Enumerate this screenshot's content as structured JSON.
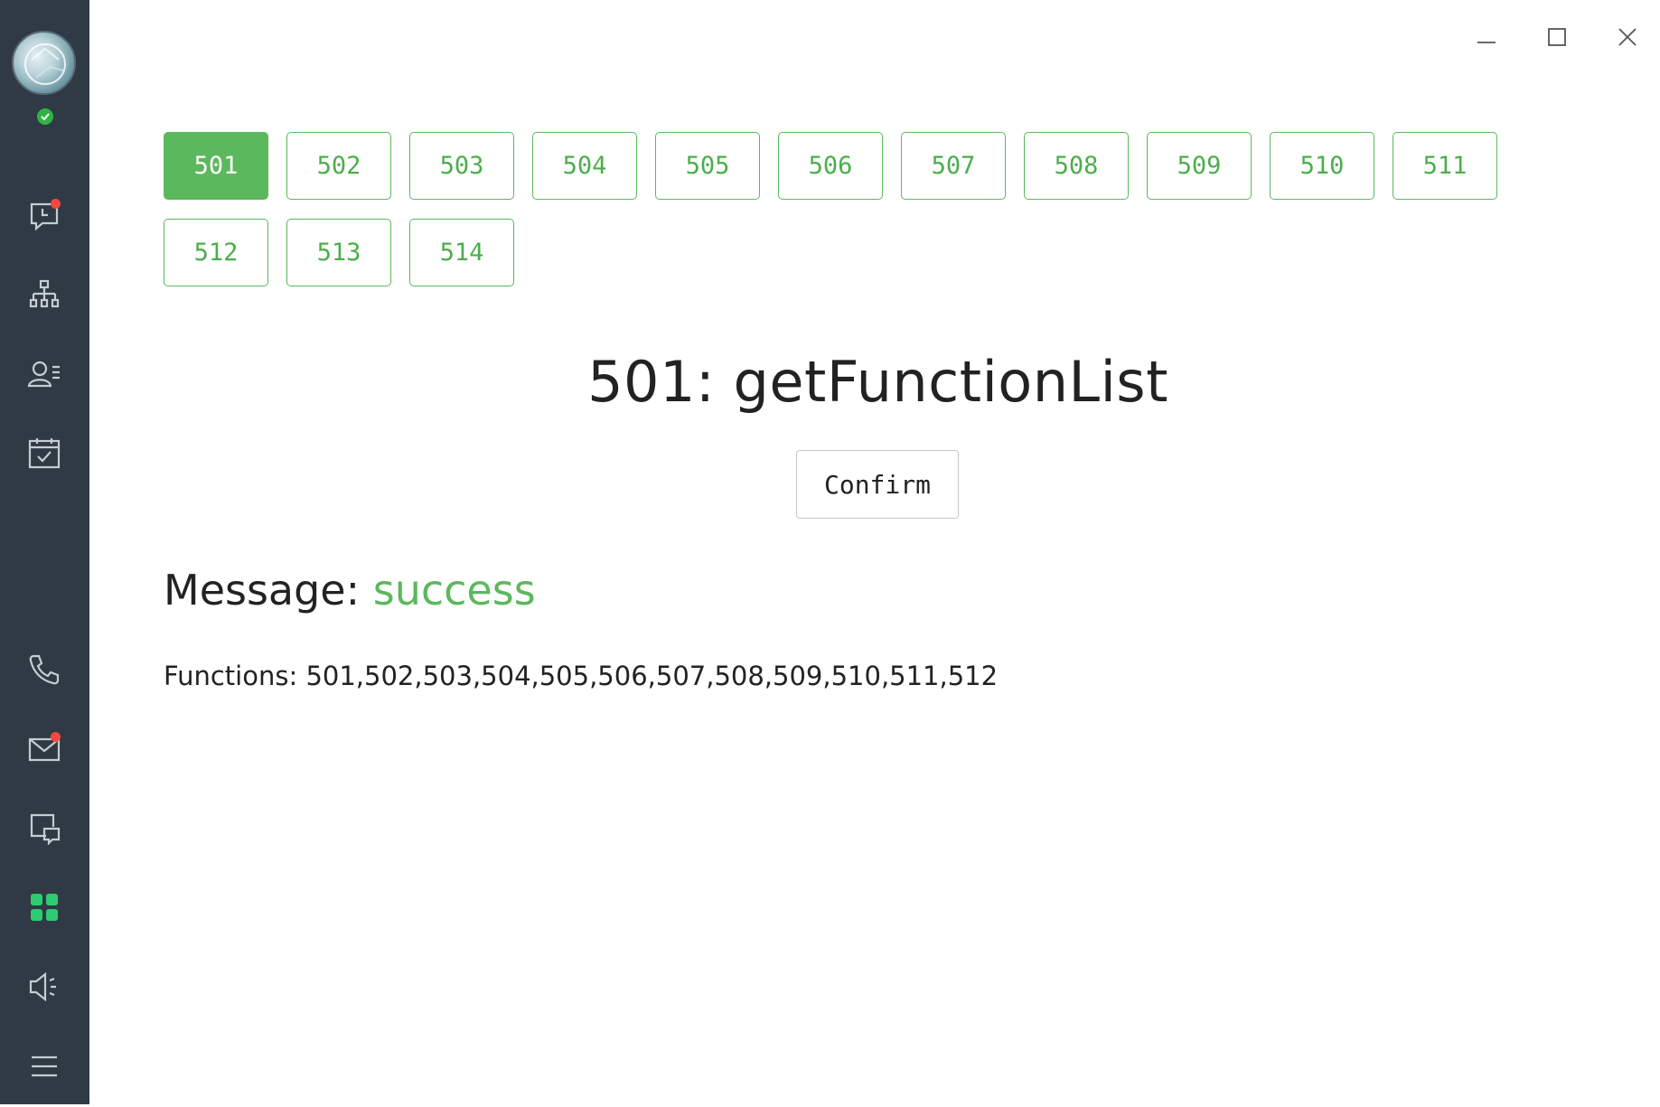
{
  "tabs": [
    "501",
    "502",
    "503",
    "504",
    "505",
    "506",
    "507",
    "508",
    "509",
    "510",
    "511",
    "512",
    "513",
    "514"
  ],
  "active_tab": "501",
  "main": {
    "title": "501: getFunctionList",
    "confirm_label": "Confirm",
    "message_label": "Message:",
    "message_value": "success",
    "functions_label": "Functions:",
    "functions_value": "501,502,503,504,505,506,507,508,509,510,511,512"
  },
  "sidebar": {
    "items": [
      {
        "name": "chat-icon",
        "badge": true
      },
      {
        "name": "org-chart-icon",
        "badge": false
      },
      {
        "name": "contacts-icon",
        "badge": false
      },
      {
        "name": "calendar-check-icon",
        "badge": false
      },
      {
        "name": "phone-icon",
        "badge": false
      },
      {
        "name": "mail-icon",
        "badge": true
      },
      {
        "name": "screen-share-icon",
        "badge": false
      },
      {
        "name": "apps-grid-icon",
        "badge": false
      },
      {
        "name": "speaker-icon",
        "badge": false
      },
      {
        "name": "menu-icon",
        "badge": false
      }
    ]
  },
  "colors": {
    "sidebar": "#2f3a44",
    "accent": "#5cb85c",
    "badge": "#f2483e",
    "status_online": "#2fb344",
    "apps_active": "#2ecc71"
  }
}
